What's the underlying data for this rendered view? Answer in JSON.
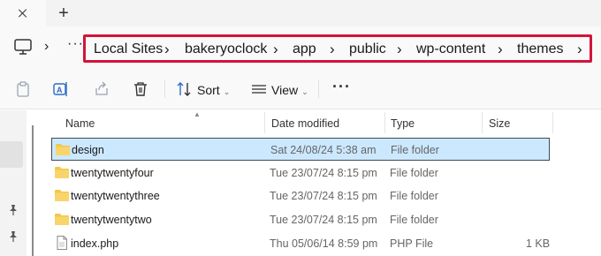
{
  "tabs": {
    "new_tab_symbol": "+"
  },
  "address_bar": {
    "overflow_symbol": "···",
    "breadcrumbs": [
      "Local Sites",
      "bakeryoclock",
      "app",
      "public",
      "wp-content",
      "themes"
    ],
    "separator": "›"
  },
  "toolbar": {
    "sort_label": "Sort",
    "view_label": "View",
    "more_symbol": "···",
    "caret": "⌄"
  },
  "columns": {
    "name": "Name",
    "date_modified": "Date modified",
    "type": "Type",
    "size": "Size"
  },
  "files": [
    {
      "name": "design",
      "date": "Sat 24/08/24 5:38 am",
      "type": "File folder",
      "size": "",
      "icon": "folder-icon",
      "selected": true
    },
    {
      "name": "twentytwentyfour",
      "date": "Tue 23/07/24 8:15 pm",
      "type": "File folder",
      "size": "",
      "icon": "folder-icon",
      "selected": false
    },
    {
      "name": "twentytwentythree",
      "date": "Tue 23/07/24 8:15 pm",
      "type": "File folder",
      "size": "",
      "icon": "folder-icon",
      "selected": false
    },
    {
      "name": "twentytwentytwo",
      "date": "Tue 23/07/24 8:15 pm",
      "type": "File folder",
      "size": "",
      "icon": "folder-icon",
      "selected": false
    },
    {
      "name": "index.php",
      "date": "Thu 05/06/14 8:59 pm",
      "type": "PHP File",
      "size": "1 KB",
      "icon": "php-file-icon",
      "selected": false
    }
  ],
  "colors": {
    "highlight_border": "#d2143a",
    "selection_fill": "#cce8ff",
    "folder_yellow": "#f4c74a"
  }
}
